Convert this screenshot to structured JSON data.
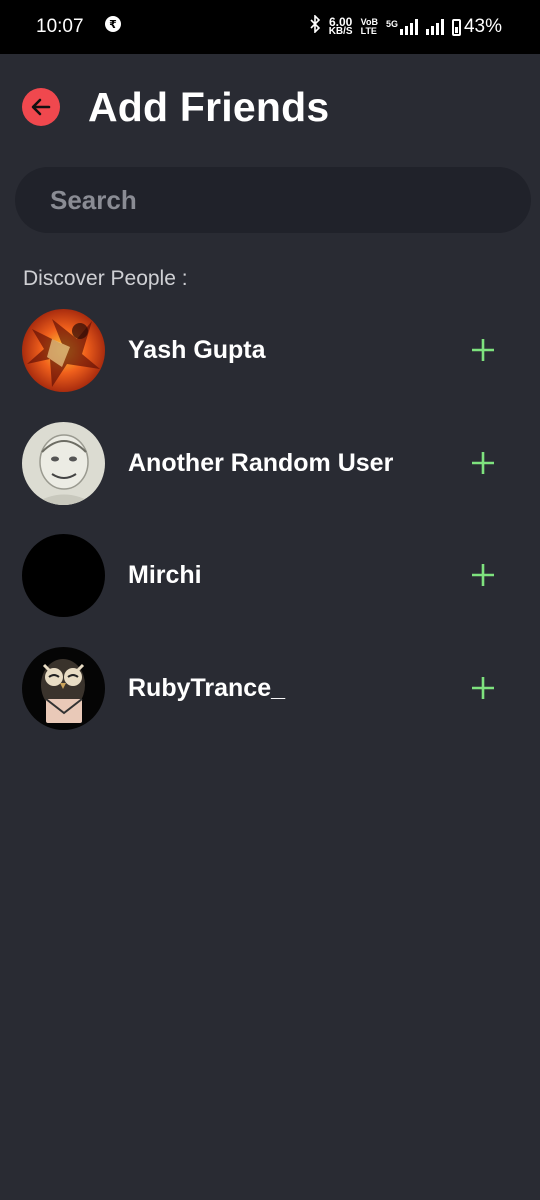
{
  "status_bar": {
    "time": "10:07",
    "speed_value": "6.00",
    "speed_unit": "KB/S",
    "volte_top": "VoB",
    "volte_bottom": "LTE",
    "network": "5G",
    "battery": "43%"
  },
  "header": {
    "title": "Add Friends"
  },
  "search": {
    "placeholder": "Search"
  },
  "discover": {
    "label": "Discover People :",
    "users": [
      {
        "name": "Yash Gupta",
        "avatar": "fiery-anime-avatar"
      },
      {
        "name": "Another Random User",
        "avatar": "sketch-face-avatar"
      },
      {
        "name": "Mirchi",
        "avatar": "black-avatar"
      },
      {
        "name": "RubyTrance_",
        "avatar": "owl-envelope-avatar"
      }
    ]
  },
  "colors": {
    "background": "#292b33",
    "search_bg": "#20222a",
    "back_button": "#f0484e",
    "add_icon": "#7ee27e"
  }
}
